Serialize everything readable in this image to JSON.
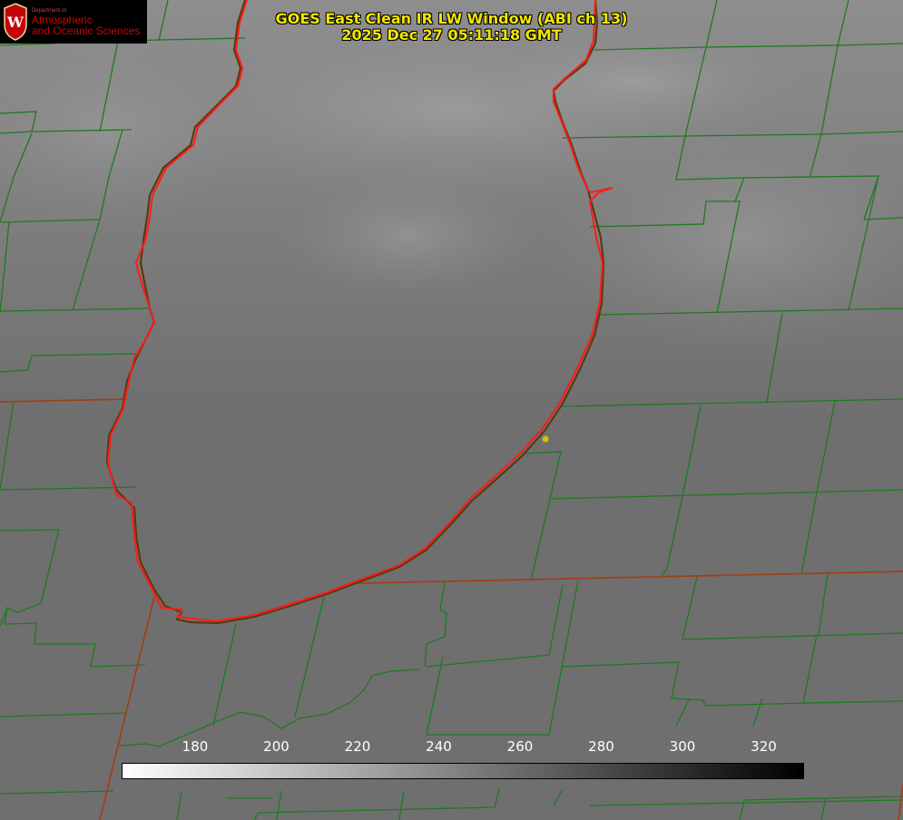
{
  "title": {
    "line1": "GOES East Clean IR LW Window (ABI ch 13)",
    "line2": "2025 Dec 27 05:11:18 GMT"
  },
  "logo": {
    "department": "Department of",
    "line1": "Atmospheric",
    "line2": "and Oceanic Sciences",
    "crest_letter": "W"
  },
  "colorbar": {
    "ticks": [
      "180",
      "200",
      "220",
      "240",
      "260",
      "280",
      "300",
      "320"
    ],
    "gradient_start": "#ffffff",
    "gradient_end": "#000000"
  },
  "colors": {
    "background": "#6e6e6e",
    "county_lines": "#1f7a1f",
    "shoreline": "#e01010",
    "title_text": "#f2e600",
    "logo_red": "#c5050c",
    "marker": "#d4c000"
  }
}
